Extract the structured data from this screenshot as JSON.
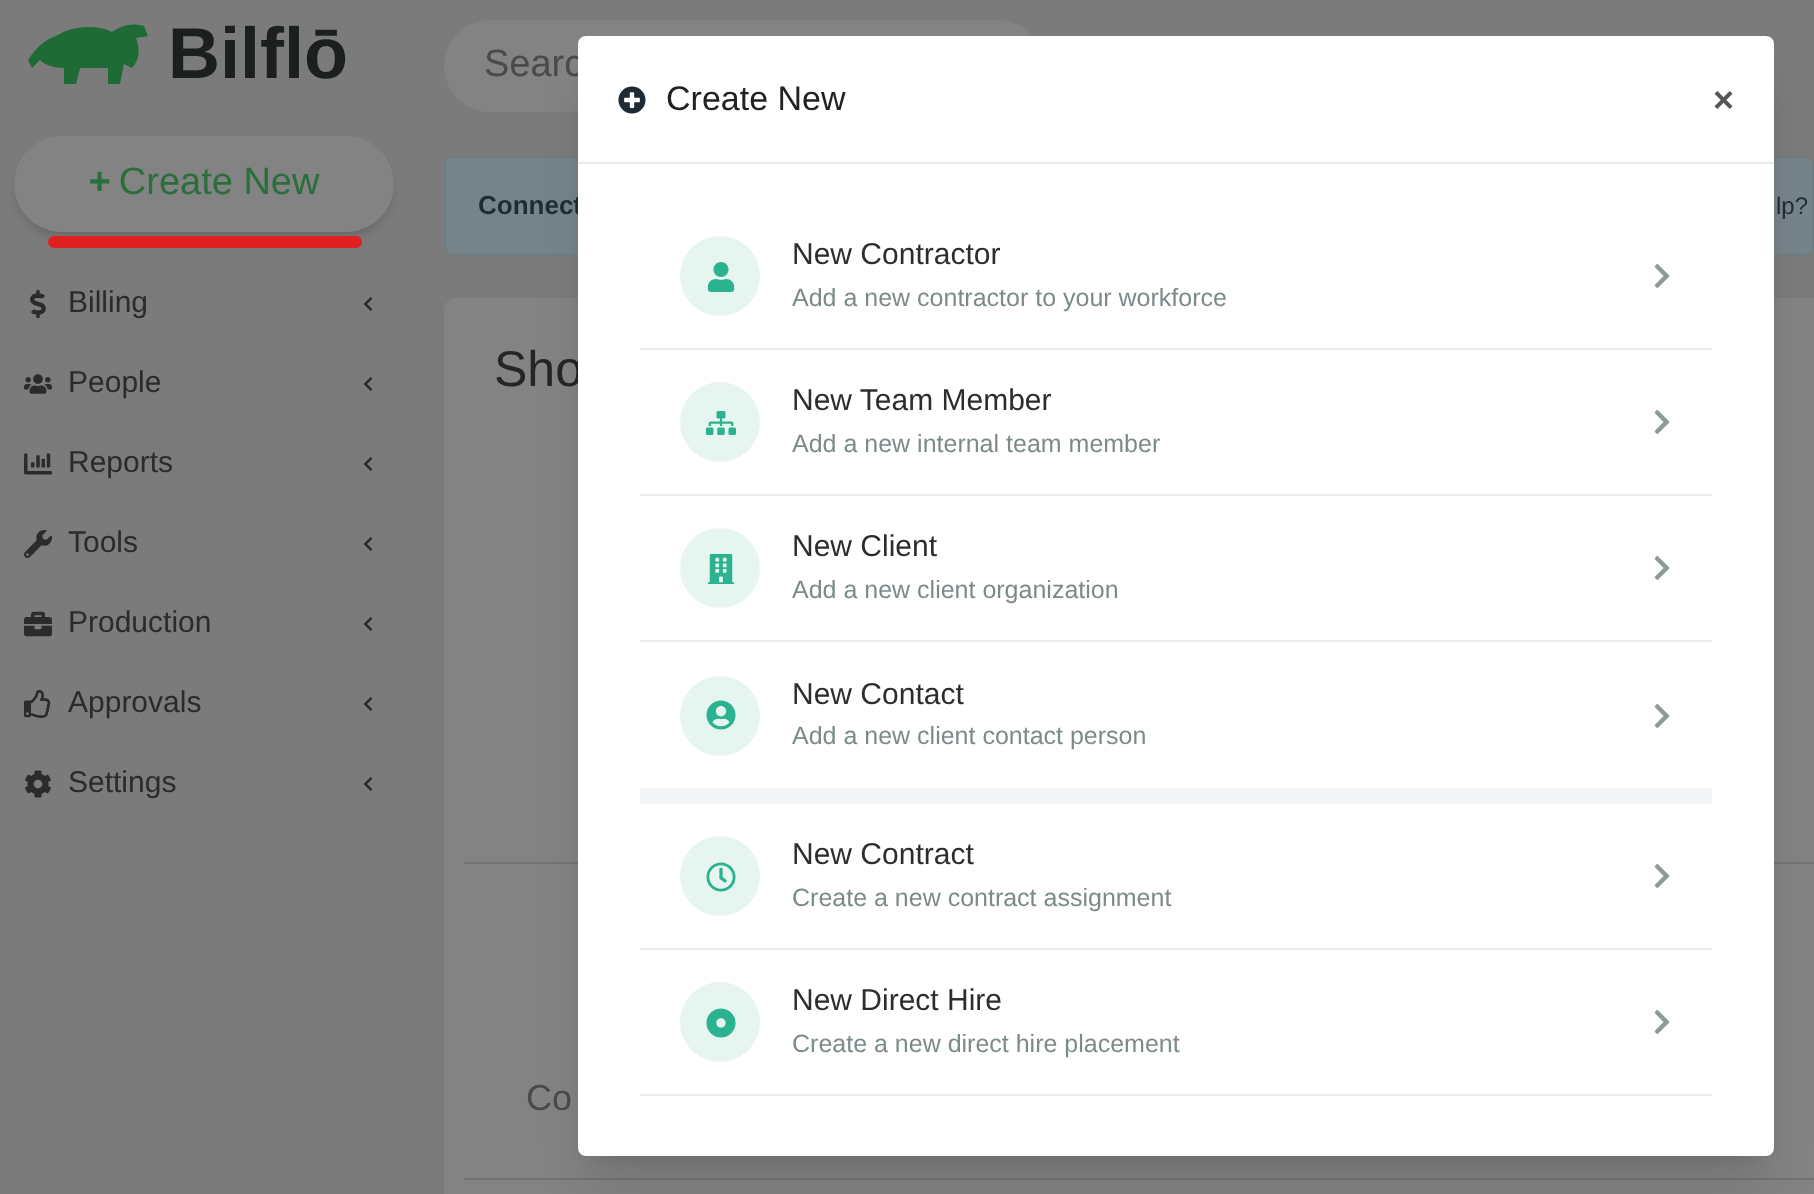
{
  "brand": {
    "name": "Bilflō"
  },
  "search": {
    "placeholder": "Searc"
  },
  "create_button": {
    "label": "Create New",
    "plus": "+"
  },
  "sidebar": {
    "items": [
      {
        "label": "Billing",
        "expanded": false
      },
      {
        "label": "People",
        "expanded": false
      },
      {
        "label": "Reports",
        "expanded": false
      },
      {
        "label": "Tools",
        "expanded": false
      },
      {
        "label": "Production",
        "expanded": false
      },
      {
        "label": "Approvals",
        "expanded": false
      },
      {
        "label": "Settings",
        "expanded": false
      }
    ]
  },
  "banner": {
    "text": "Connect",
    "help": "lp?"
  },
  "card": {
    "title": "Sho",
    "text_3": "Co"
  },
  "modal": {
    "title": "Create New",
    "close": "×",
    "groups": [
      {
        "items": [
          {
            "title": "New Contractor",
            "description": "Add a new contractor to your workforce"
          },
          {
            "title": "New Team Member",
            "description": "Add a new internal team member"
          },
          {
            "title": "New Client",
            "description": "Add a new client organization"
          },
          {
            "title": "New Contact",
            "description": "Add a new client contact person"
          }
        ]
      },
      {
        "items": [
          {
            "title": "New Contract",
            "description": "Create a new contract assignment"
          },
          {
            "title": "New Direct Hire",
            "description": "Create a new direct hire placement"
          }
        ]
      }
    ]
  }
}
